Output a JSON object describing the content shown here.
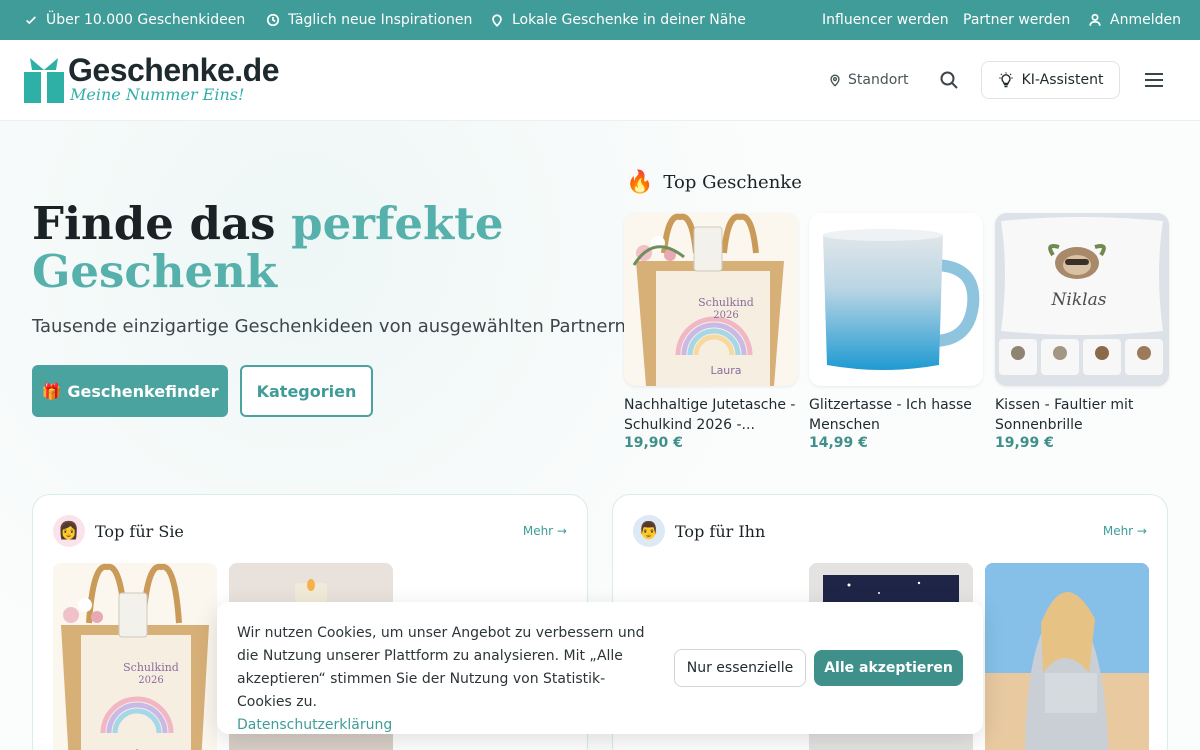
{
  "topbar": {
    "benefit_1": "Über 10.000 Geschenkideen",
    "benefit_2": "Täglich neue Inspirationen",
    "benefit_3": "Lokale Geschenke in deiner Nähe",
    "link_influencer": "Influencer werden",
    "link_partner": "Partner werden",
    "link_login": "Anmelden"
  },
  "header": {
    "logo_name": "Geschenke.de",
    "logo_tagline": "Meine Nummer Eins!",
    "location_label": "Standort",
    "ki_label": "KI-Assistent"
  },
  "hero": {
    "title_part1": "Finde das ",
    "title_accent1": "perfekte",
    "title_accent2": "Geschenk",
    "subtitle": "Tausende einzigartige Geschenkideen von ausgewählten Partnern.",
    "primary_button": "Geschenkefinder",
    "primary_button_icon": "🎁",
    "secondary_button": "Kategorien"
  },
  "top_gifts": {
    "title": "Top Geschenke",
    "icon": "🔥",
    "items": [
      {
        "name": "Nachhaltige Jutetasche - Schulkind 2026 -...",
        "price": "19,90 €",
        "bag_line1": "Schulkind",
        "bag_line2": "2026",
        "bag_name": "Laura"
      },
      {
        "name": "Glitzertasse - Ich hasse Menschen",
        "price": "14,99 €"
      },
      {
        "name": "Kissen - Faultier mit Sonnenbrille",
        "price": "19,99 €",
        "pillow_name": "Niklas"
      }
    ]
  },
  "cards": {
    "her": {
      "title": "Top für Sie",
      "avatar": "👩",
      "more": "Mehr →"
    },
    "him": {
      "title": "Top für Ihn",
      "avatar": "👨",
      "more": "Mehr →"
    }
  },
  "cookie": {
    "text": "Wir nutzen Cookies, um unser Angebot zu verbessern und die Nutzung unserer Plattform zu analysieren. Mit „Alle akzeptieren“ stimmen Sie der Nutzung von Statistik-Cookies zu.",
    "link": "Datenschutzerklärung",
    "essential_button": "Nur essenzielle",
    "accept_button": "Alle akzeptieren"
  },
  "colors": {
    "brand": "#3f9c98",
    "brand_dark": "#3f8f8a",
    "accent_text": "#56b0ab"
  }
}
